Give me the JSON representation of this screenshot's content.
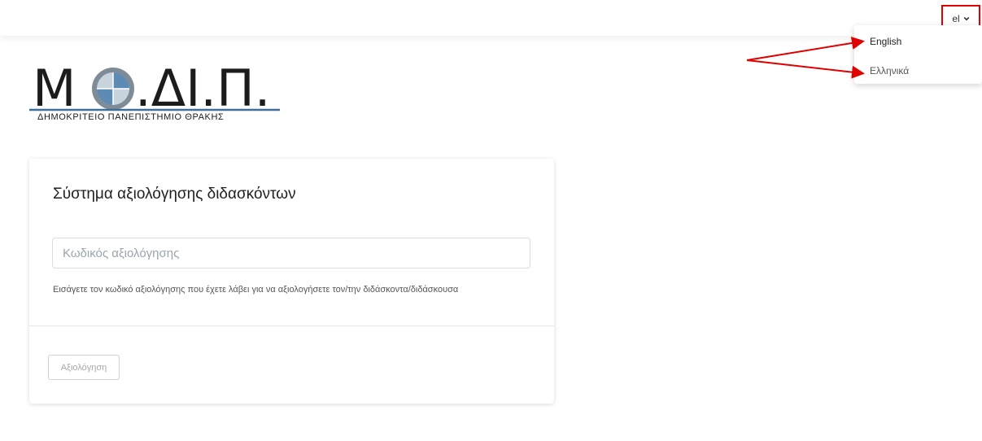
{
  "header": {
    "language_toggle": {
      "label": "el"
    },
    "language_menu": {
      "items": [
        {
          "label": "English"
        },
        {
          "label": "Ελληνικά"
        }
      ]
    }
  },
  "logo": {
    "wordmark": "Μ◉.ΔΙ.Π.",
    "subtitle": "ΔΗΜΟΚΡΙΤΕΙΟ ΠΑΝΕΠΙΣΤΗΜΙΟ ΘΡΑΚΗΣ"
  },
  "card": {
    "title": "Σύστημα αξιολόγησης διδασκόντων",
    "code_input": {
      "value": "",
      "placeholder": "Κωδικός αξιολόγησης"
    },
    "help_text": "Εισάγετε τον κωδικό αξιολόγησης που έχετε λάβει για να αξιολογήσετε τον/την διδάσκοντα/διδάσκουσα",
    "submit_label": "Αξιολόγηση"
  },
  "annotations": {
    "highlight_color": "#e00000"
  },
  "icons": {
    "chevron": "chevron-down-icon"
  }
}
